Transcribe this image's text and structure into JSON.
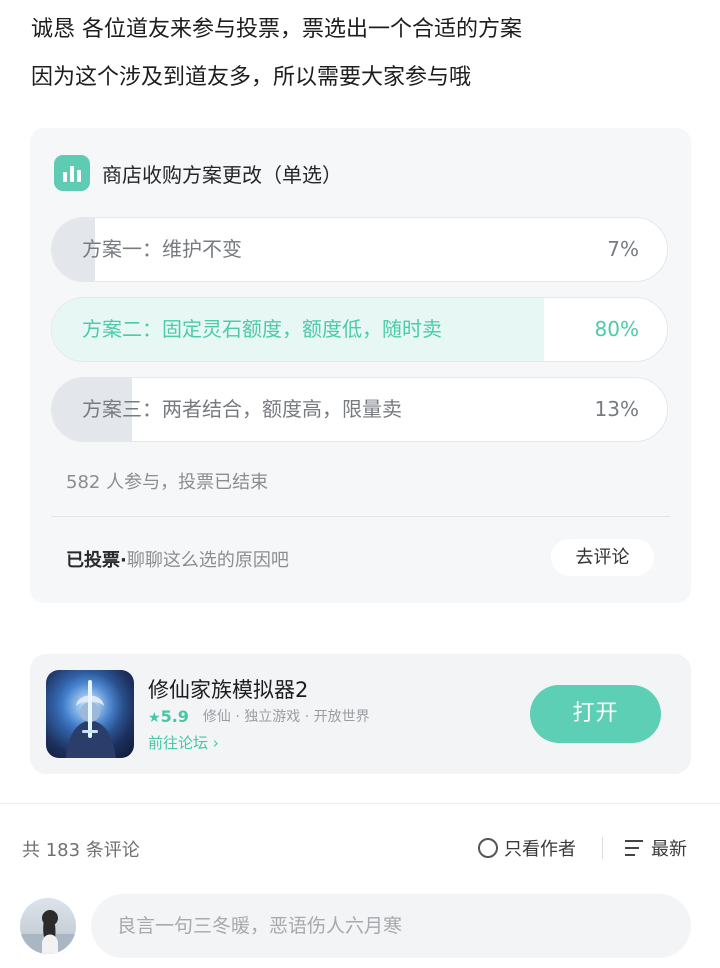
{
  "post": {
    "lines": [
      "诚恳 各位道友来参与投票，票选出一个合适的方案",
      "因为这个涉及到道友多，所以需要大家参与哦"
    ]
  },
  "poll": {
    "icon": "bar-chart-icon",
    "title": "商店收购方案更改（单选）",
    "options": [
      {
        "label": "方案一：维护不变",
        "percent_text": "7%",
        "share": 0.07,
        "selected": false
      },
      {
        "label": "方案二：固定灵石额度，额度低，随时卖",
        "percent_text": "80%",
        "share": 0.8,
        "selected": true
      },
      {
        "label": "方案三：两者结合，额度高，限量卖",
        "percent_text": "13%",
        "share": 0.13,
        "selected": false
      }
    ],
    "meta": "582 人参与，投票已结束",
    "voted_label": "已投票·",
    "voted_hint": "聊聊这么选的原因吧",
    "comment_button": "去评论"
  },
  "game": {
    "title": "修仙家族模拟器2",
    "star": "★",
    "score": "5.9",
    "tags": "修仙 · 独立游戏 · 开放世界",
    "forum_link": "前往论坛",
    "forum_arrow": "›",
    "open_button": "打开"
  },
  "comments": {
    "count_text": "共 183 条评论",
    "author_only": "只看作者",
    "sort": "最新",
    "input_placeholder": "良言一句三冬暖，恶语伤人六月寒"
  },
  "colors": {
    "accent": "#5dcfb4",
    "accent_text": "#46c6a6"
  }
}
